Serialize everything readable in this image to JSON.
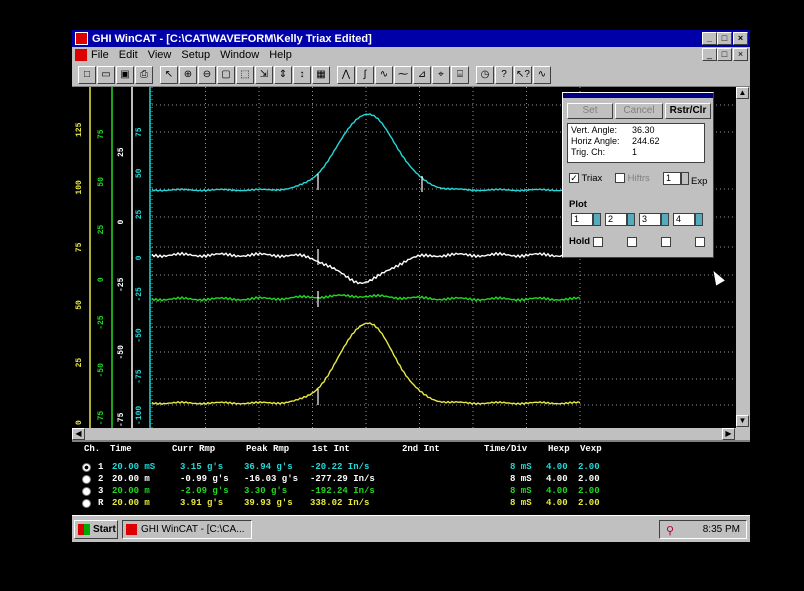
{
  "window": {
    "title": "GHI WinCAT - [C:\\CAT\\WAVEFORM\\Kelly Triax Edited]",
    "min_glyph": "_",
    "max_glyph": "□",
    "close_glyph": "×"
  },
  "menu": [
    "File",
    "Edit",
    "View",
    "Setup",
    "Window",
    "Help"
  ],
  "toolbar_icons": [
    "new-icon",
    "open-icon",
    "save-icon",
    "print-icon",
    "cursor-icon",
    "zoom-in-icon",
    "zoom-out-icon",
    "zoom-box-icon",
    "range-icon",
    "zoom-fit-icon",
    "scroll-up-down-icon",
    "scroll-vert-icon",
    "grid-icon",
    "peak-icon",
    "integrate-icon",
    "filter-icon",
    "wave-icon",
    "fft-icon",
    "measure-icon",
    "report-icon",
    "clock-icon",
    "help-icon",
    "whats-this-icon",
    "triax-icon"
  ],
  "toolbar_glyphs": [
    "□",
    "▭",
    "▣",
    "⎙",
    "↖",
    "⊕",
    "⊖",
    "▢",
    "⬚",
    "⇲",
    "⇕",
    "↕",
    "▦",
    "⋀",
    "∫",
    "∿",
    "⁓",
    "⊿",
    "⌖",
    "⌸",
    "◷",
    "?",
    "↖?",
    "∿"
  ],
  "colors": {
    "ch1": "#22d8d8",
    "ch2": "#ffffff",
    "ch3": "#22d822",
    "ch4": "#e8e840",
    "grid": "#9a9a9a",
    "panel_btn_on": "#000000",
    "panel_btn_off": "#808080"
  },
  "plot": {
    "axes": [
      {
        "name": "ch4-axis",
        "color": "#e8e840",
        "labels": [
          "125",
          "100",
          "75",
          "50",
          "25",
          "0"
        ]
      },
      {
        "name": "ch1-axis",
        "color": "#22d822",
        "labels": [
          "75",
          "50",
          "25",
          "0",
          "-25",
          "-50",
          "-75"
        ]
      },
      {
        "name": "ch2-axis",
        "color": "#ffffff",
        "labels": [
          "25",
          "0",
          "-25",
          "-50",
          "-75"
        ]
      },
      {
        "name": "ch3-axis",
        "color": "#22d8d8",
        "labels": [
          "75",
          "50",
          "25",
          "0",
          "-25",
          "-50",
          "-75",
          "-100"
        ]
      }
    ]
  },
  "panel": {
    "set_label": "Set",
    "cancel_label": "Cancel",
    "rstr_label": "Rstr/Clr",
    "vert_label": "Vert. Angle:",
    "vert_value": "36.30",
    "horz_label": "Horiz Angle:",
    "horz_value": "244.62",
    "trig_label": "Trig. Ch:",
    "trig_value": "1",
    "triax_label": "Triax",
    "triax_mark": "✓",
    "filter_label": "Hiftrs",
    "exp_value": "1",
    "exp_label": "Exp",
    "plot_label": "Plot",
    "plot_values": [
      "1",
      "2",
      "3",
      "4"
    ],
    "hold_label": "Hold"
  },
  "table": {
    "headers": [
      "Ch.",
      "Time",
      "Curr Rmp",
      "Peak Rmp",
      "1st Int",
      "2nd Int",
      "Time/Div",
      "Hexp",
      "Vexp"
    ],
    "rows": [
      {
        "ch": "1",
        "time": "20.00 mS",
        "curr": "3.15 g's",
        "peak": "36.94 g's",
        "int1": "-20.22 In/s",
        "int2": "",
        "tdiv": "8 mS",
        "hexp": "4.00",
        "vexp": "2.00",
        "color": "#22d8d8",
        "selected": true
      },
      {
        "ch": "2",
        "time": "20.00 m",
        "curr": "-0.99 g's",
        "peak": "-16.03 g's",
        "int1": "-277.29 In/s",
        "int2": "",
        "tdiv": "8 mS",
        "hexp": "4.00",
        "vexp": "2.00",
        "color": "#ffffff",
        "selected": false
      },
      {
        "ch": "3",
        "time": "20.00 m",
        "curr": "-2.09 g's",
        "peak": "3.30 g's",
        "int1": "-192.24 In/s",
        "int2": "",
        "tdiv": "8 mS",
        "hexp": "4.00",
        "vexp": "2.00",
        "color": "#22d822",
        "selected": false
      },
      {
        "ch": "R",
        "time": "20.00 m",
        "curr": "3.91 g's",
        "peak": "39.93 g's",
        "int1": "338.02 In/s",
        "int2": "",
        "tdiv": "8 mS",
        "hexp": "4.00",
        "vexp": "2.00",
        "color": "#e8e840",
        "selected": false
      }
    ]
  },
  "taskbar": {
    "start_label": "Start",
    "task_label": "GHI WinCAT - [C:\\CA...",
    "clock": "8:35 PM"
  }
}
